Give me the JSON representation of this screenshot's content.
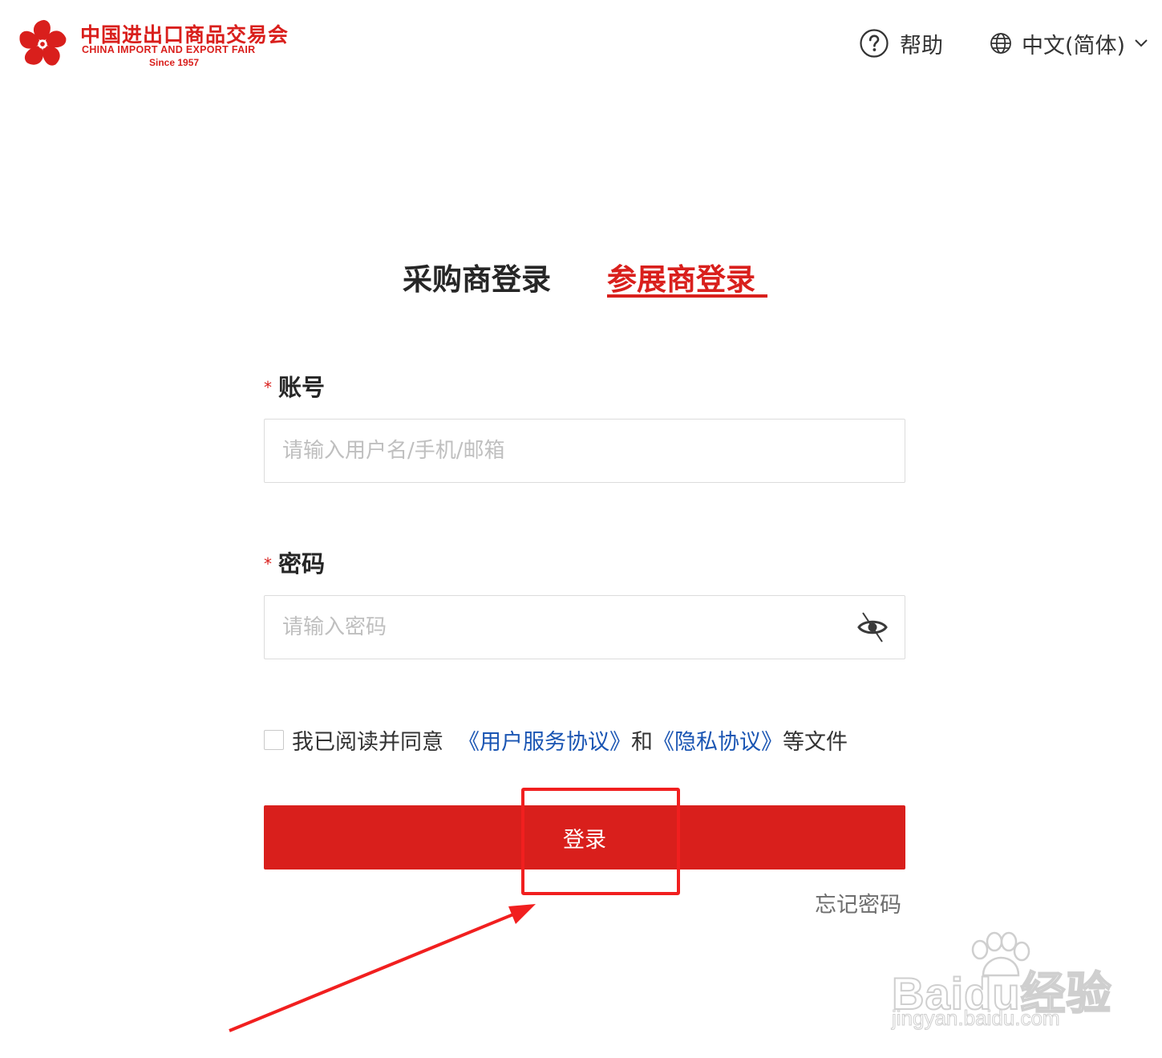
{
  "header": {
    "logo": {
      "cn_name": "中国进出口商品交易会",
      "en_name": "CHINA IMPORT AND EXPORT FAIR",
      "since": "Since 1957"
    },
    "help_label": "帮助",
    "language_label": "中文(简体)"
  },
  "tabs": [
    {
      "label": "采购商登录",
      "active": false
    },
    {
      "label": "参展商登录",
      "active": true
    }
  ],
  "form": {
    "required_mark": "*",
    "account_label": "账号",
    "account_placeholder": "请输入用户名/手机/邮箱",
    "password_label": "密码",
    "password_placeholder": "请输入密码"
  },
  "agreement": {
    "checked": false,
    "prefix": "我已阅读并同意",
    "terms_link": "《用户服务协议》",
    "and": "和",
    "privacy_link": "《隐私协议》",
    "suffix": "等文件"
  },
  "login_button": "登录",
  "forgot_password": "忘记密码",
  "watermark": {
    "brand": "Baidu经验",
    "url": "jingyan.baidu.com"
  },
  "colors": {
    "brand_red": "#d91f1c",
    "link_blue": "#1a55b3",
    "annotation_red": "#f11f1f"
  }
}
